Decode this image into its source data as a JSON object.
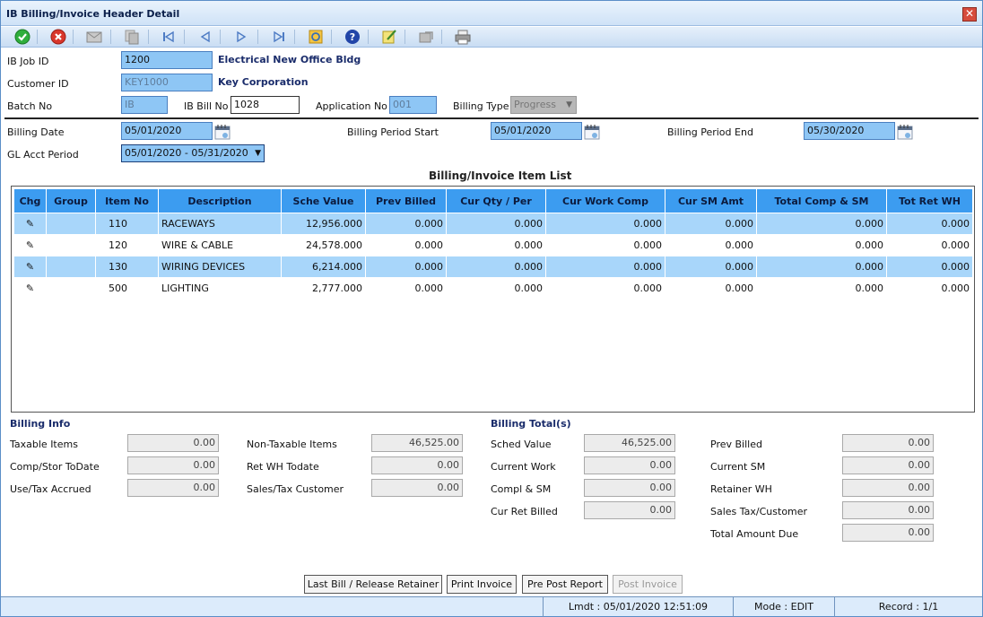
{
  "window": {
    "title": "IB Billing/Invoice Header Detail"
  },
  "toolbar": [
    {
      "name": "save-icon"
    },
    {
      "name": "cancel-icon"
    },
    {
      "name": "mail-icon"
    },
    {
      "name": "copy-icon"
    },
    {
      "name": "first-record-icon"
    },
    {
      "name": "prev-record-icon"
    },
    {
      "name": "next-record-icon"
    },
    {
      "name": "last-record-icon"
    },
    {
      "name": "refresh-icon"
    },
    {
      "name": "help-icon"
    },
    {
      "name": "notes-icon"
    },
    {
      "name": "export-icon"
    },
    {
      "name": "print-icon"
    }
  ],
  "header": {
    "job_id_label": "IB Job ID",
    "job_id": "1200",
    "job_name": "Electrical New Office Bldg",
    "customer_id_label": "Customer ID",
    "customer_id": "KEY1000",
    "customer_name": "Key Corporation",
    "batch_no_label": "Batch No",
    "batch_no": "IB",
    "bill_no_label": "IB Bill No",
    "bill_no": "1028",
    "application_no_label": "Application No",
    "application_no": "001",
    "billing_type_label": "Billing Type",
    "billing_type": "Progress",
    "billing_date_label": "Billing Date",
    "billing_date": "05/01/2020",
    "period_start_label": "Billing Period Start",
    "period_start": "05/01/2020",
    "period_end_label": "Billing Period End",
    "period_end": "05/30/2020",
    "gl_period_label": "GL Acct Period",
    "gl_period": "05/01/2020 - 05/31/2020"
  },
  "item_list": {
    "title": "Billing/Invoice Item List",
    "columns": [
      "Chg",
      "Group",
      "Item No",
      "Description",
      "Sche Value",
      "Prev Billed",
      "Cur Qty / Per",
      "Cur Work Comp",
      "Cur SM Amt",
      "Total Comp & SM",
      "Tot Ret WH"
    ],
    "rows": [
      {
        "group": "",
        "item_no": "110",
        "description": "RACEWAYS",
        "sche_value": "12,956.000",
        "prev_billed": "0.000",
        "cur_qty": "0.000",
        "cur_work": "0.000",
        "cur_sm": "0.000",
        "total_comp": "0.000",
        "tot_ret": "0.000"
      },
      {
        "group": "",
        "item_no": "120",
        "description": "WIRE & CABLE",
        "sche_value": "24,578.000",
        "prev_billed": "0.000",
        "cur_qty": "0.000",
        "cur_work": "0.000",
        "cur_sm": "0.000",
        "total_comp": "0.000",
        "tot_ret": "0.000"
      },
      {
        "group": "",
        "item_no": "130",
        "description": "WIRING DEVICES",
        "sche_value": "6,214.000",
        "prev_billed": "0.000",
        "cur_qty": "0.000",
        "cur_work": "0.000",
        "cur_sm": "0.000",
        "total_comp": "0.000",
        "tot_ret": "0.000"
      },
      {
        "group": "",
        "item_no": "500",
        "description": "LIGHTING",
        "sche_value": "2,777.000",
        "prev_billed": "0.000",
        "cur_qty": "0.000",
        "cur_work": "0.000",
        "cur_sm": "0.000",
        "total_comp": "0.000",
        "tot_ret": "0.000"
      }
    ]
  },
  "billing_info": {
    "title": "Billing Info",
    "taxable_items_label": "Taxable Items",
    "taxable_items": "0.00",
    "comp_stor_label": "Comp/Stor ToDate",
    "comp_stor": "0.00",
    "use_tax_label": "Use/Tax Accrued",
    "use_tax": "0.00",
    "non_taxable_label": "Non-Taxable Items",
    "non_taxable": "46,525.00",
    "ret_wh_label": "Ret WH Todate",
    "ret_wh": "0.00",
    "sales_tax_label": "Sales/Tax Customer",
    "sales_tax": "0.00"
  },
  "billing_totals": {
    "title": "Billing Total(s)",
    "sched_value_label": "Sched Value",
    "sched_value": "46,525.00",
    "current_work_label": "Current Work",
    "current_work": "0.00",
    "compl_sm_label": "Compl & SM",
    "compl_sm": "0.00",
    "cur_ret_label": "Cur Ret Billed",
    "cur_ret": "0.00",
    "prev_billed_label": "Prev Billed",
    "prev_billed": "0.00",
    "current_sm_label": "Current SM",
    "current_sm": "0.00",
    "retainer_wh_label": "Retainer WH",
    "retainer_wh": "0.00",
    "sales_tax_cust_label": "Sales Tax/Customer",
    "sales_tax_cust": "0.00",
    "total_due_label": "Total Amount Due",
    "total_due": "0.00"
  },
  "actions": {
    "last_bill": "Last Bill / Release Retainer",
    "print_invoice": "Print Invoice",
    "pre_post": "Pre Post Report",
    "post_invoice": "Post Invoice"
  },
  "status": {
    "lmdt": "Lmdt : 05/01/2020 12:51:09",
    "mode": "Mode : EDIT",
    "record": "Record : 1/1"
  }
}
